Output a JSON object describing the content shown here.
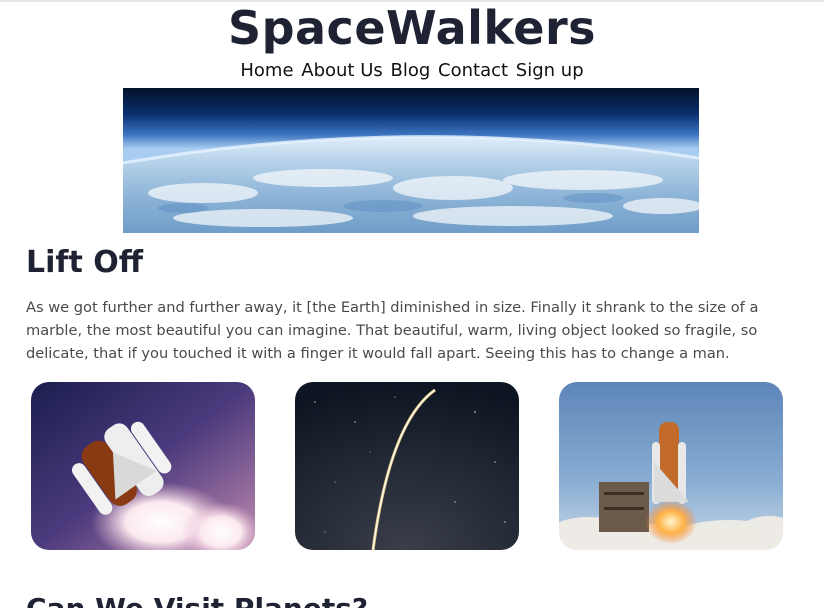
{
  "site": {
    "title": "SpaceWalkers"
  },
  "nav": {
    "items": [
      {
        "label": "Home"
      },
      {
        "label": "About Us"
      },
      {
        "label": "Blog"
      },
      {
        "label": "Contact"
      },
      {
        "label": "Sign up"
      }
    ]
  },
  "hero": {
    "image": "earth-from-orbit"
  },
  "section1": {
    "heading": "Lift Off",
    "paragraph": "As we got further and further away, it [the Earth] diminished in size. Finally it shrank to the size of a marble, the most beautiful you can imagine. That beautiful, warm, living object looked so fragile, so delicate, that if you touched it with a finger it would fall apart. Seeing this has to change a man."
  },
  "gallery": {
    "images": [
      "space-shuttle-liftoff",
      "rocket-trail-night",
      "shuttle-launch-pad"
    ]
  },
  "section2": {
    "heading": "Can We Visit Planets?"
  }
}
